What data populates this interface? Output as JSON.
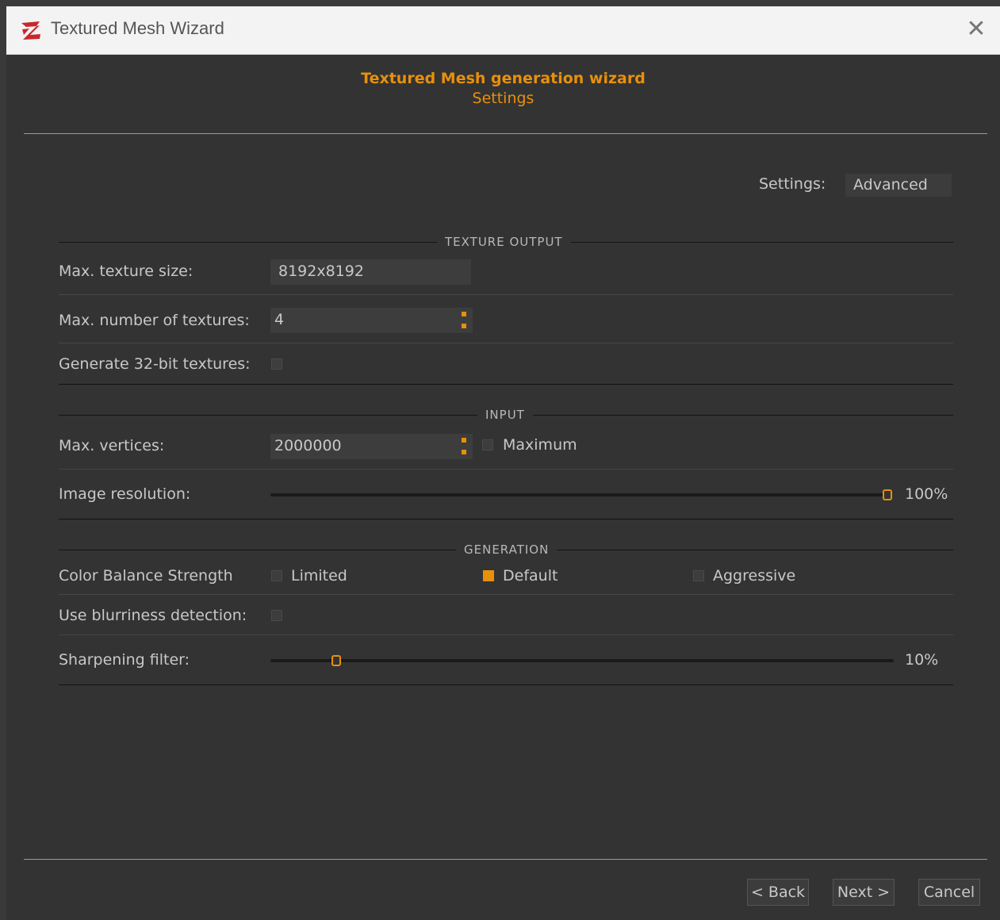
{
  "window": {
    "title": "Textured Mesh Wizard",
    "app_icon": "3dzephyr-logo-icon",
    "close_icon": "close-icon"
  },
  "header": {
    "title": "Textured Mesh generation wizard",
    "subtitle": "Settings"
  },
  "settings_mode": {
    "label": "Settings:",
    "value": "Advanced"
  },
  "texture_output": {
    "group_title": "TEXTURE OUTPUT",
    "max_texture_size": {
      "label": "Max. texture size:",
      "value": "8192x8192"
    },
    "max_textures": {
      "label": "Max. number of textures:",
      "value": "4"
    },
    "gen_32bit": {
      "label": "Generate 32-bit textures:",
      "checked": false
    }
  },
  "input": {
    "group_title": "INPUT",
    "max_vertices": {
      "label": "Max. vertices:",
      "value": "2000000",
      "maximum_label": "Maximum",
      "maximum_checked": false
    },
    "image_resolution": {
      "label": "Image resolution:",
      "value_text": "100%",
      "percent": 100
    }
  },
  "generation": {
    "group_title": "GENERATION",
    "color_balance": {
      "label": "Color Balance Strength",
      "options": [
        {
          "label": "Limited",
          "checked": false
        },
        {
          "label": "Default",
          "checked": true
        },
        {
          "label": "Aggressive",
          "checked": false
        }
      ]
    },
    "blurriness": {
      "label": "Use blurriness detection:",
      "checked": false
    },
    "sharpening": {
      "label": "Sharpening filter:",
      "value_text": "10%",
      "percent": 10
    }
  },
  "buttons": {
    "back": "< Back",
    "next": "Next >",
    "cancel": "Cancel"
  },
  "colors": {
    "accent": "#e8900c",
    "background": "#333333",
    "text": "#c8c8c8"
  }
}
